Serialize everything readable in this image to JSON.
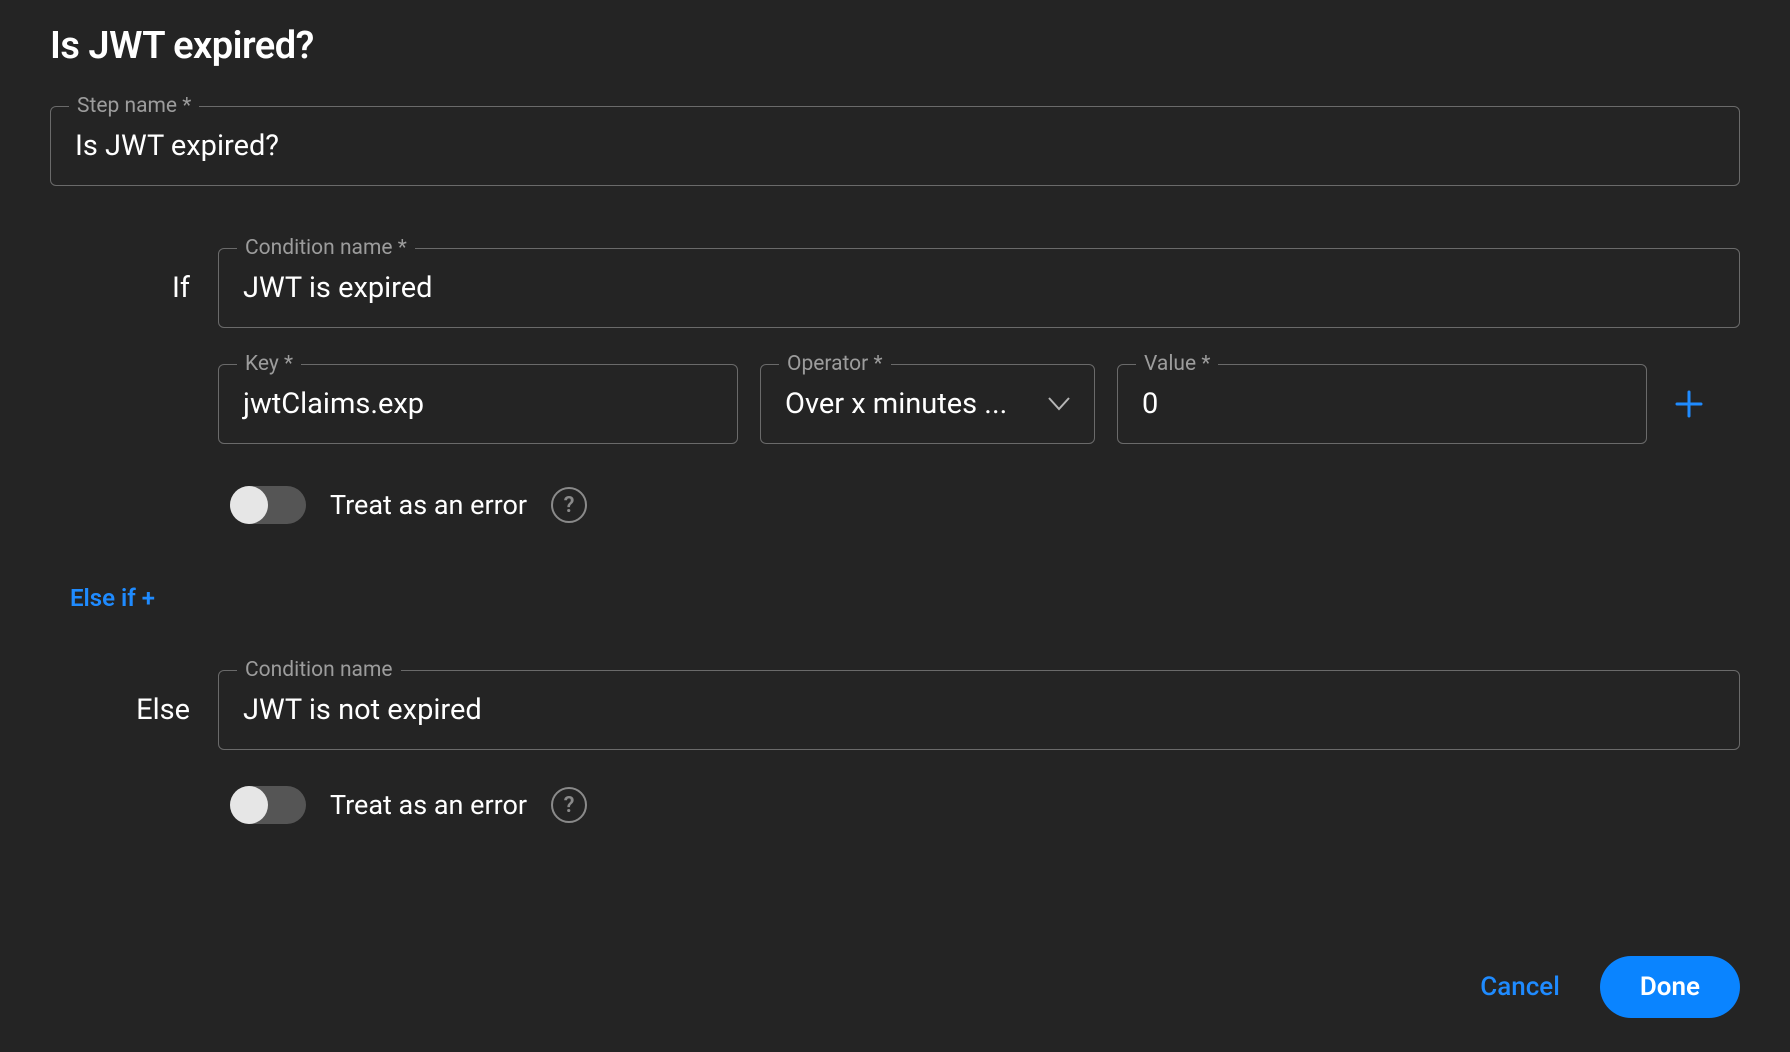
{
  "title": "Is JWT expired?",
  "step_name": {
    "label": "Step name *",
    "value": "Is JWT expired?"
  },
  "if": {
    "row_label": "If",
    "condition_name": {
      "label": "Condition name *",
      "value": "JWT is expired"
    },
    "key": {
      "label": "Key *",
      "value": "jwtClaims.exp"
    },
    "operator": {
      "label": "Operator *",
      "value": "Over x minutes ..."
    },
    "value": {
      "label": "Value *",
      "value": "0"
    },
    "treat_as_error_label": "Treat as an error",
    "treat_as_error": false
  },
  "else_if_label": "Else if +",
  "else": {
    "row_label": "Else",
    "condition_name": {
      "label": "Condition name",
      "value": "JWT is not expired"
    },
    "treat_as_error_label": "Treat as an error",
    "treat_as_error": false
  },
  "footer": {
    "cancel": "Cancel",
    "done": "Done"
  },
  "colors": {
    "accent": "#0a84ff",
    "link": "#1f8bff",
    "bg": "#242424",
    "border": "#6a6a6a"
  }
}
